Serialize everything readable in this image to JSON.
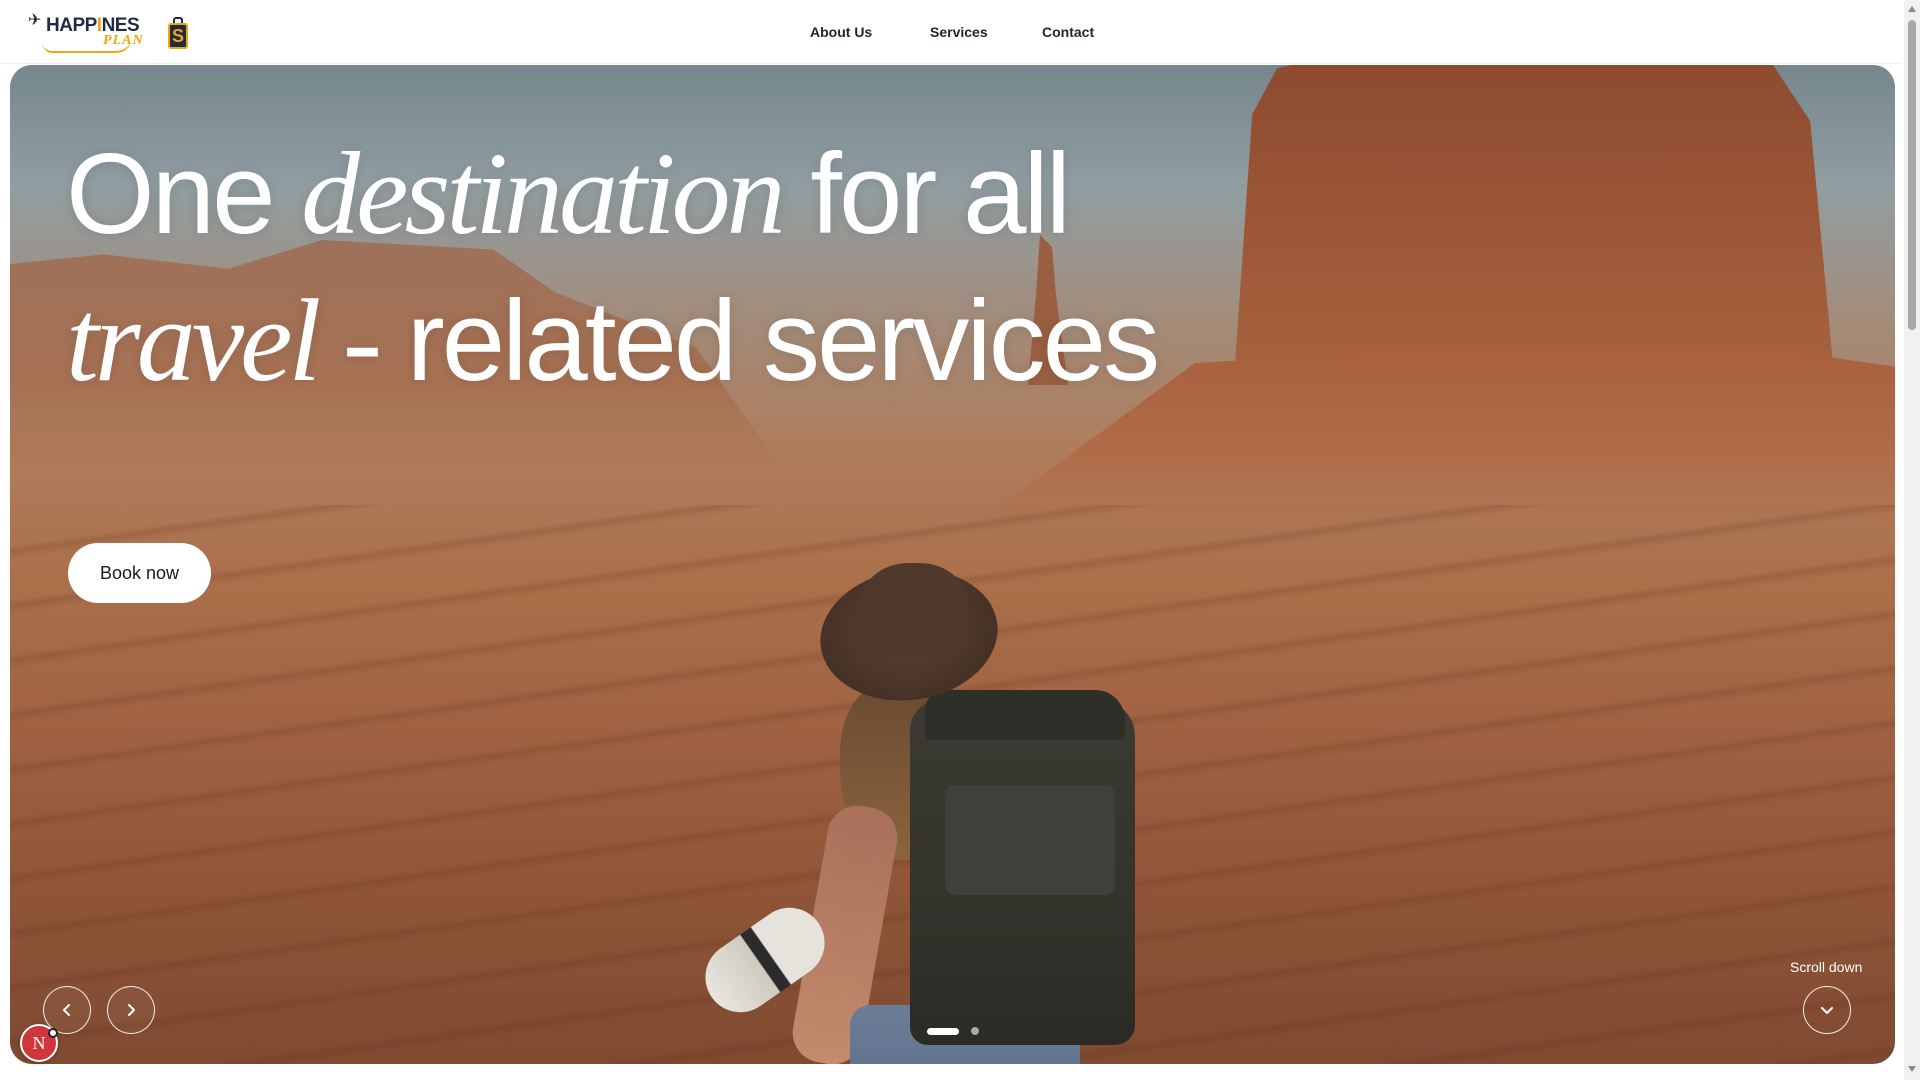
{
  "brand": {
    "logo_text_main": "HAPP",
    "logo_text_dot": "I",
    "logo_text_rest": "NES",
    "logo_text_sub": "PLAN",
    "logo_bag_letter": "S",
    "logo_plane_icon": "✈",
    "colors": {
      "navy": "#1f2a44",
      "gold": "#f2a50c"
    }
  },
  "nav": {
    "items": [
      {
        "label": "About Us"
      },
      {
        "label": "Services"
      },
      {
        "label": "Contact"
      }
    ]
  },
  "hero": {
    "title_line1_a": "One",
    "title_line1_serif": "destination",
    "title_line1_b": "for all",
    "title_line2_serif": "travel -",
    "title_line2_b": "related services",
    "cta_label": "Book now",
    "scroll_label": "Scroll down",
    "slides": {
      "count": 2,
      "active": 1
    }
  },
  "floating_badge": {
    "letter": "N",
    "color": "#d0373c"
  }
}
